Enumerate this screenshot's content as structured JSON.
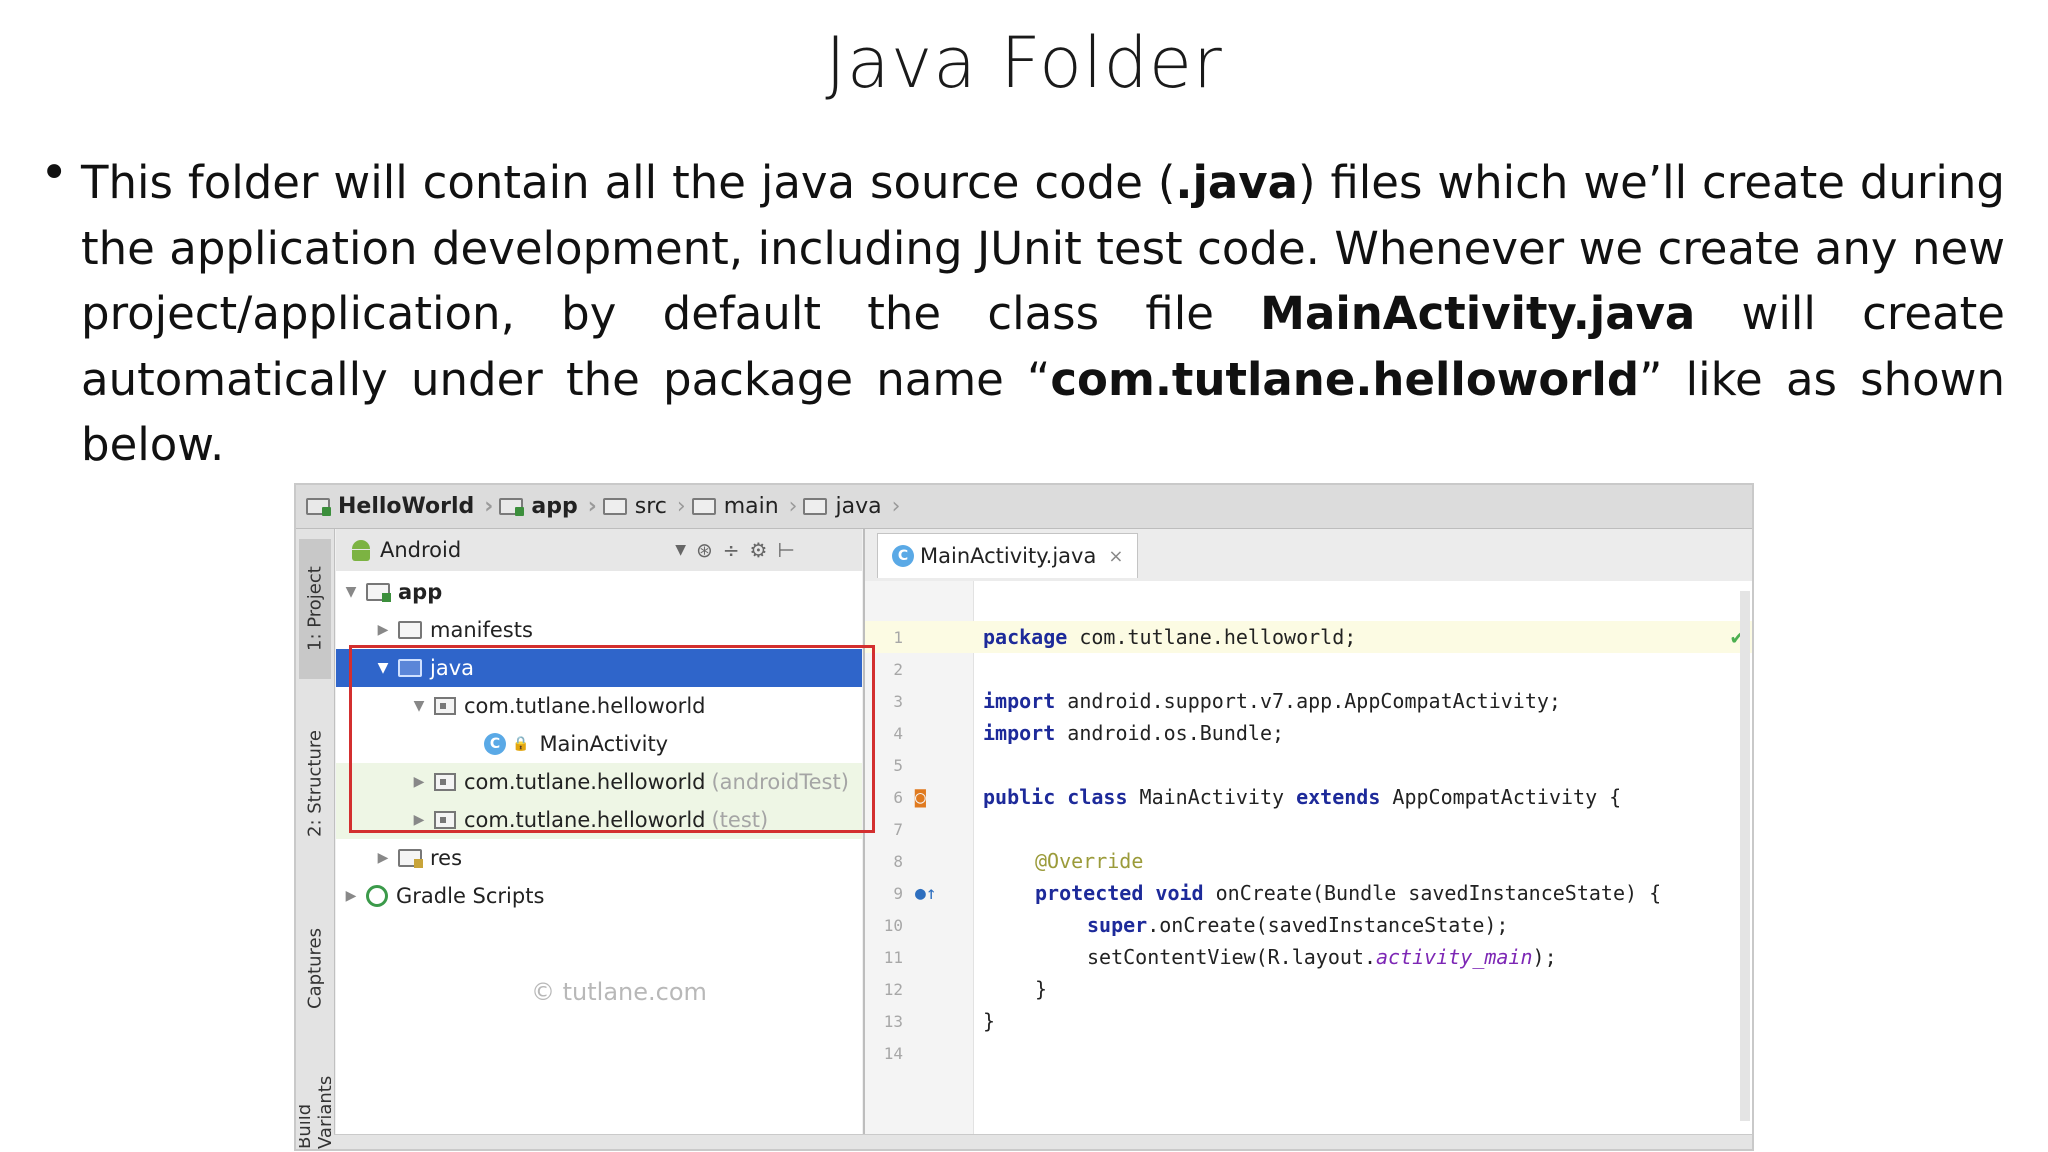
{
  "slide": {
    "title": "Java Folder",
    "bullet": "•",
    "p1": "This folder will contain all the java source code (",
    "p1_bold": ".java",
    "p2": ") files which we’ll create during the application development, including JUnit test code. Whenever we create any new project/application, by default the class file ",
    "p2_bold": "MainActivity.java",
    "p3": " will create automatically under the package name “",
    "p3_bold": "com.tutlane.helloworld",
    "p4": "” like as shown below."
  },
  "ide": {
    "breadcrumbs": [
      "HelloWorld",
      "app",
      "src",
      "main",
      "java"
    ],
    "side_tabs": [
      "1: Project",
      "2: Structure",
      "Captures",
      "Build Variants"
    ],
    "project_view": "Android",
    "tree": [
      {
        "label": "app",
        "muted": ""
      },
      {
        "label": "manifests",
        "muted": ""
      },
      {
        "label": "java",
        "muted": ""
      },
      {
        "label": "com.tutlane.helloworld",
        "muted": ""
      },
      {
        "label": "MainActivity",
        "muted": ""
      },
      {
        "label": "com.tutlane.helloworld",
        "muted": "(androidTest)"
      },
      {
        "label": "com.tutlane.helloworld",
        "muted": "(test)"
      },
      {
        "label": "res",
        "muted": ""
      },
      {
        "label": "Gradle Scripts",
        "muted": ""
      }
    ],
    "watermark": "© tutlane.com",
    "editor_tab": "MainActivity.java",
    "editor_tab_close": "×",
    "code": {
      "l1_kw": "package",
      "l1": " com.tutlane.helloworld;",
      "l3_kw": "import",
      "l3": " android.support.v7.app.AppCompatActivity;",
      "l4_kw": "import",
      "l4": " android.os.Bundle;",
      "l6_kw1": "public class",
      "l6_a": " MainActivity ",
      "l6_kw2": "extends",
      "l6_b": " AppCompatActivity {",
      "l8": "@Override",
      "l9_kw": "protected void",
      "l9": " onCreate(Bundle savedInstanceState) {",
      "l10_kw": "super",
      "l10": ".onCreate(savedInstanceState);",
      "l11_a": "setContentView(R.layout.",
      "l11_field": "activity_main",
      "l11_b": ");",
      "l12": "}",
      "l13": "}"
    },
    "line_numbers": [
      "1",
      "2",
      "3",
      "4",
      "5",
      "6",
      "7",
      "8",
      "9",
      "10",
      "11",
      "12",
      "13",
      "14"
    ]
  }
}
